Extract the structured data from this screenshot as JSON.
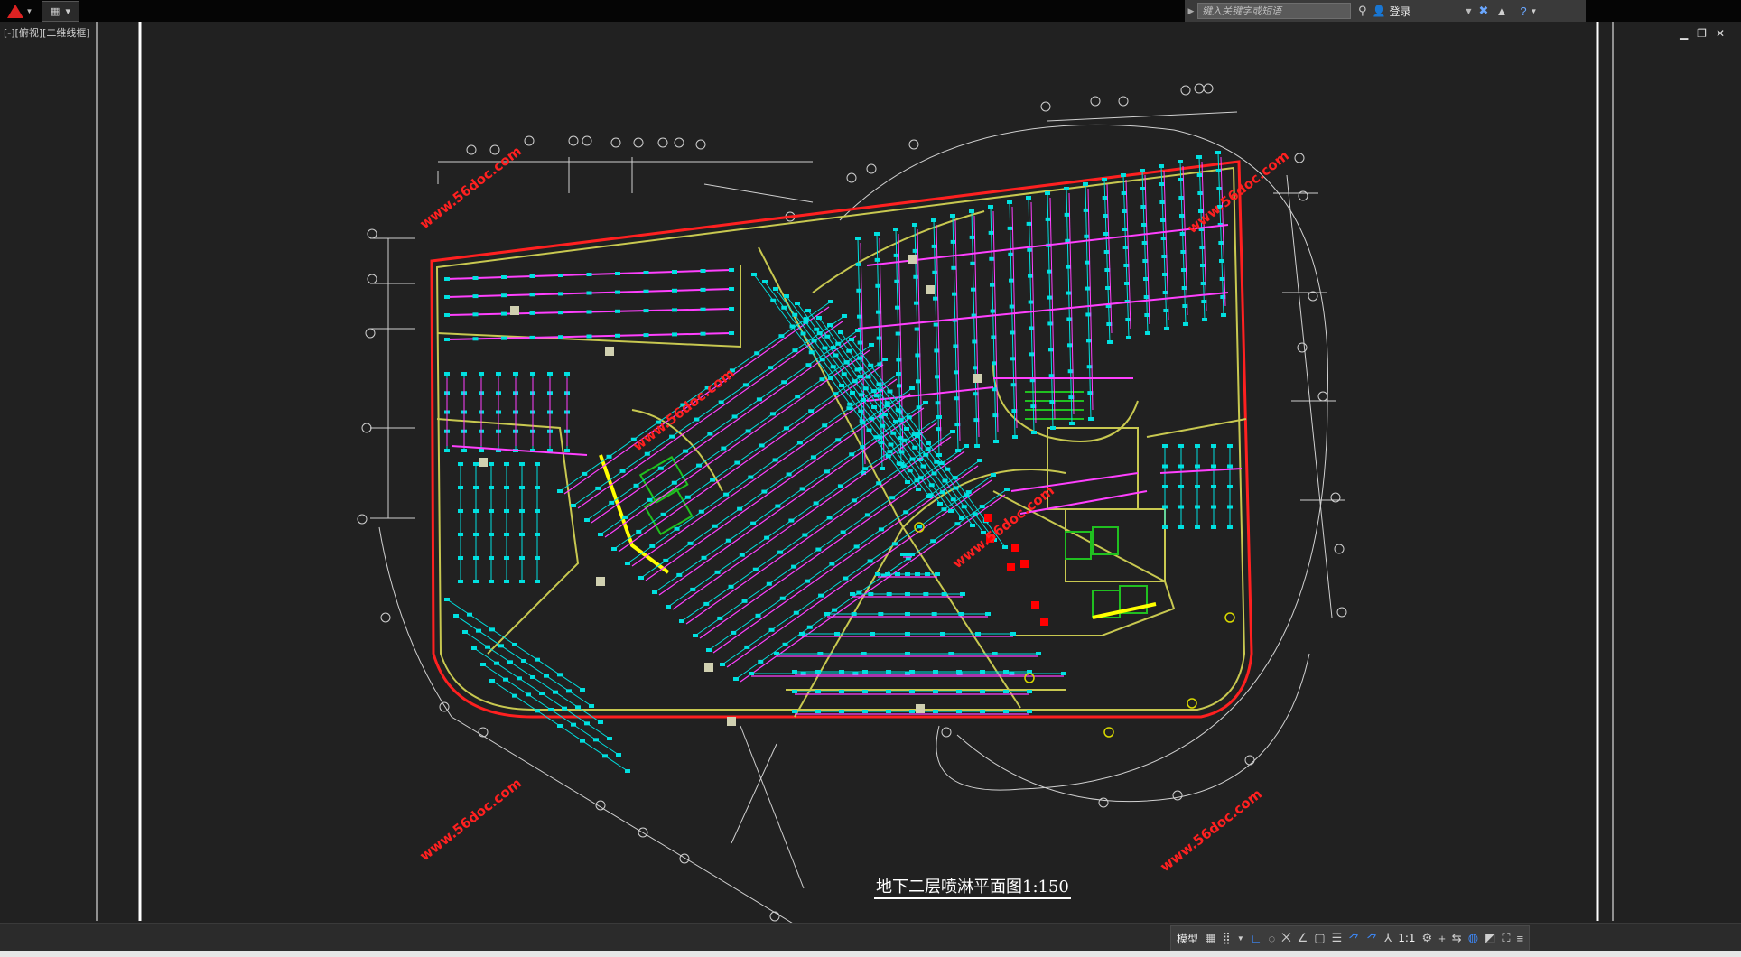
{
  "titlebar": {
    "search_placeholder": "键入关键字或短语",
    "login_label": "登录"
  },
  "viewport": {
    "label": "[-][俯视][二维线框]"
  },
  "drawing": {
    "title": "地下二层喷淋平面图1:150",
    "watermark": "www.56doc.com",
    "colors": {
      "background": "#212121",
      "boundary": "#ff2020",
      "walls": "#c8c850",
      "sprinkler_pipes": "#ff40ff",
      "sprinkler_heads": "#00e0e0",
      "dimensions": "#ffffff",
      "fixtures": "#20c020"
    }
  },
  "statusbar": {
    "model_label": "模型",
    "scale_label": "1:1"
  }
}
